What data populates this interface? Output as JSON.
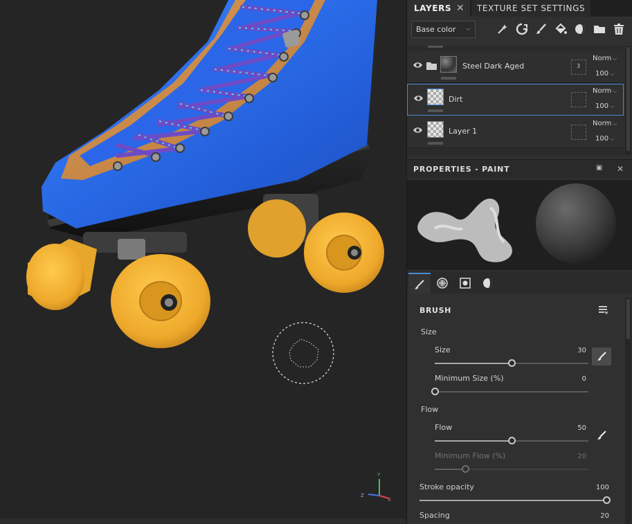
{
  "tabs": {
    "layers": "LAYERS",
    "close": "✕",
    "texture_set": "TEXTURE SET SETTINGS"
  },
  "channel_dropdown": {
    "value": "Base color"
  },
  "layer_tools": [
    "add-effect-icon",
    "add-fill-icon",
    "add-paint-icon",
    "fill-bucket-icon",
    "mask-icon",
    "folder-icon",
    "trash-icon"
  ],
  "layers": [
    {
      "name": "Steel Dark Aged",
      "kind": "folder",
      "mask_count": "3",
      "blend": "Norm",
      "opacity": "100"
    },
    {
      "name": "Dirt",
      "kind": "paint",
      "blend": "Norm",
      "opacity": "100",
      "selected": true
    },
    {
      "name": "Layer 1",
      "kind": "paint",
      "blend": "Norm",
      "opacity": "100"
    }
  ],
  "properties": {
    "title": "PROPERTIES - PAINT"
  },
  "property_tabs": [
    "brush-tab-icon",
    "material-tab-icon",
    "stencil-tab-icon",
    "alpha-tab-icon"
  ],
  "brush": {
    "title": "BRUSH",
    "size_group": "Size",
    "size_label": "Size",
    "size_value": "30",
    "size_fraction": 0.5,
    "min_size_label": "Minimum Size (%)",
    "min_size_value": "0",
    "min_size_fraction": 0.0,
    "flow_group": "Flow",
    "flow_label": "Flow",
    "flow_value": "50",
    "flow_fraction": 0.5,
    "min_flow_label": "Minimum Flow (%)",
    "min_flow_value": "20",
    "min_flow_fraction": 0.2,
    "stroke_opacity_label": "Stroke opacity",
    "stroke_opacity_value": "100",
    "stroke_opacity_fraction": 1.0,
    "spacing_label": "Spacing",
    "spacing_value": "20"
  },
  "axis_gizmo": {
    "y": "Y",
    "z": "Z",
    "x": "X"
  },
  "colors": {
    "accent": "#4a8fd6",
    "boot_blue": "#2f6fe6",
    "wheel_yellow": "#f3b234",
    "suede_tan": "#c98a4a"
  }
}
